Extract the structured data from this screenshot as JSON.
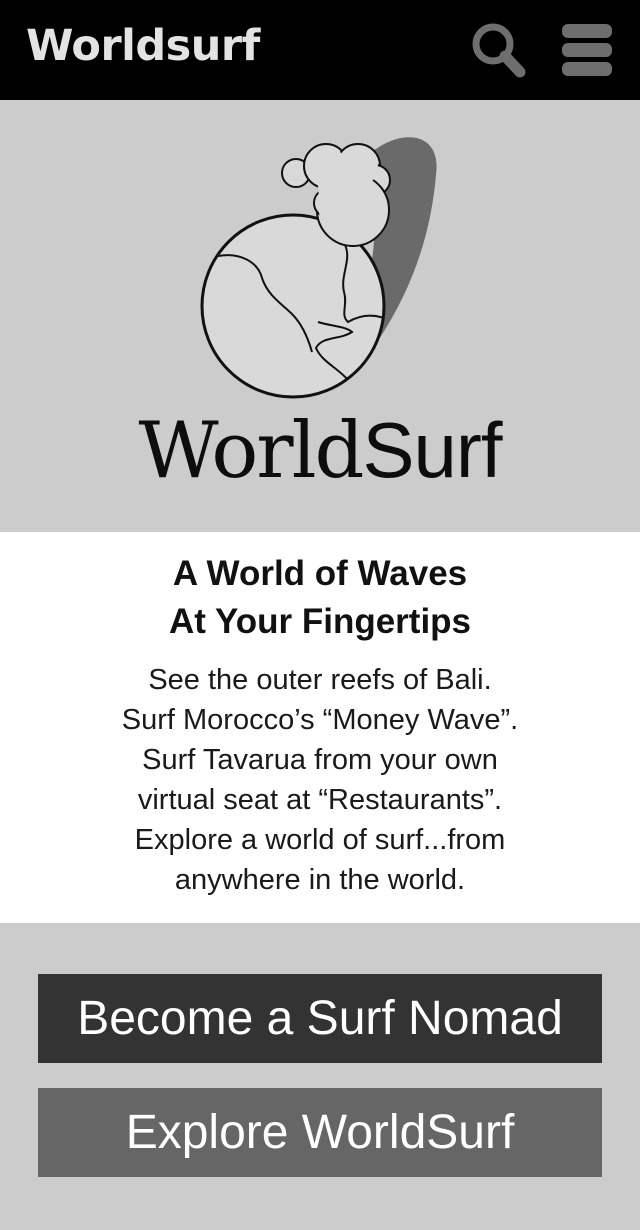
{
  "header": {
    "app_title": "Worldsurf",
    "search_icon": "search-icon",
    "menu_icon": "hamburger-menu-icon"
  },
  "hero": {
    "logo_icon": "globe-surfer-logo",
    "brand_part1": "World",
    "brand_part2": "Surf"
  },
  "info": {
    "headline_line1": "A World of Waves",
    "headline_line2": "At Your Fingertips",
    "body_lines": [
      "See the outer reefs of Bali.",
      "Surf Morocco’s “Money Wave”.",
      "Surf Tavarua from your own",
      "virtual seat at “Restaurants”.",
      "Explore a world of surf...from",
      "anywhere in the world."
    ]
  },
  "actions": {
    "primary_label": "Become a Surf Nomad",
    "secondary_label": "Explore WorldSurf"
  },
  "colors": {
    "header_bg": "#000000",
    "page_bg": "#cccccc",
    "info_bg": "#ffffff",
    "primary_button": "#333333",
    "secondary_button": "#666666"
  }
}
